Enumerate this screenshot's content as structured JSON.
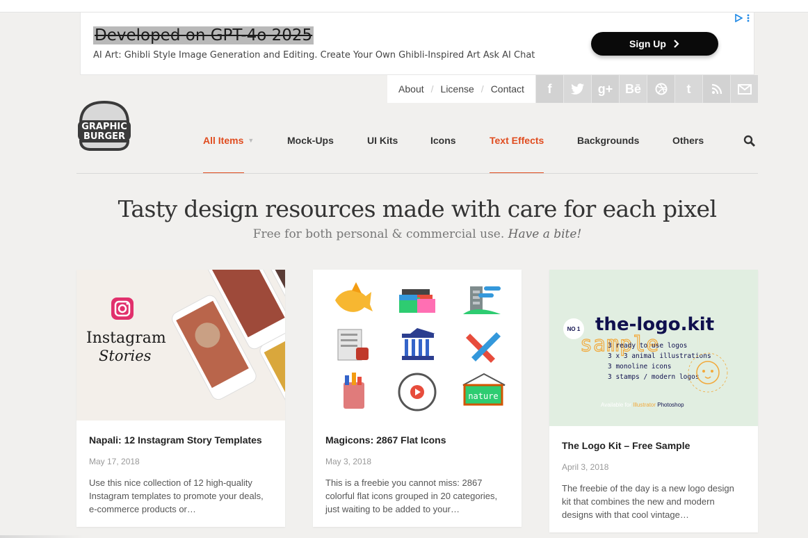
{
  "ad": {
    "title": "Developed on GPT-4o 2025",
    "description": "AI Art: Ghibli Style Image Generation and Editing. Create Your Own Ghibli-Inspired Art Ask AI Chat",
    "button_label": "Sign Up",
    "button_icon": "chevron-right-icon",
    "adchoices_icon": "adchoices-icon"
  },
  "toplinks": [
    "About",
    "License",
    "Contact"
  ],
  "socials": [
    {
      "name": "facebook-icon",
      "glyph": "f"
    },
    {
      "name": "twitter-icon",
      "glyph": "🐦"
    },
    {
      "name": "google-plus-icon",
      "glyph": "g+"
    },
    {
      "name": "behance-icon",
      "glyph": "Bē"
    },
    {
      "name": "dribbble-icon",
      "glyph": "◎"
    },
    {
      "name": "tumblr-icon",
      "glyph": "t"
    },
    {
      "name": "rss-icon",
      "glyph": "◥"
    },
    {
      "name": "mail-icon",
      "glyph": "✉"
    }
  ],
  "logo": {
    "line1": "GRAPHIC",
    "line2": "BURGER"
  },
  "nav": {
    "all_items": "All Items",
    "mockups": "Mock-Ups",
    "ui_kits": "UI Kits",
    "icons": "Icons",
    "text_effects": "Text Effects",
    "backgrounds": "Backgrounds",
    "others": "Others"
  },
  "colors": {
    "accent": "#e04c1f",
    "background": "#f1f0ee"
  },
  "hero": {
    "title": "Tasty design resources made with care for each pixel",
    "subtitle": "Free for both personal & commercial use.",
    "subtitle_em": "Have a bite!"
  },
  "cards": [
    {
      "title": "Napali: 12 Instagram Story Templates",
      "date": "May 17, 2018",
      "desc": "Use this nice collection of 12 high-quality Instagram templates to promote your deals, e-commerce products or…",
      "img_text1": "Instagram",
      "img_text2": "Stories"
    },
    {
      "title": "Magicons: 2867 Flat Icons",
      "date": "May 3, 2018",
      "desc": "This is a freebie you cannot miss: 2867 colorful flat icons grouped in 20 categories, just waiting to be added to your…",
      "sign_text": "nature"
    },
    {
      "title": "The Logo Kit – Free Sample",
      "date": "April 3, 2018",
      "desc": "The freebie of the day is a new logo design kit that combines the new and modern designs with that cool vintage…",
      "img_no": "NO 1",
      "img_title": "the-logo.kit",
      "img_sample": "sample",
      "img_lines": [
        "3 ready to use logos",
        "3 x 3 animal illustrations",
        "3 monoline icons",
        "3 stamps / modern logos"
      ],
      "img_foot1": "Available for",
      "img_foot2": "Illustrator",
      "img_foot3": "Photoshop"
    }
  ]
}
